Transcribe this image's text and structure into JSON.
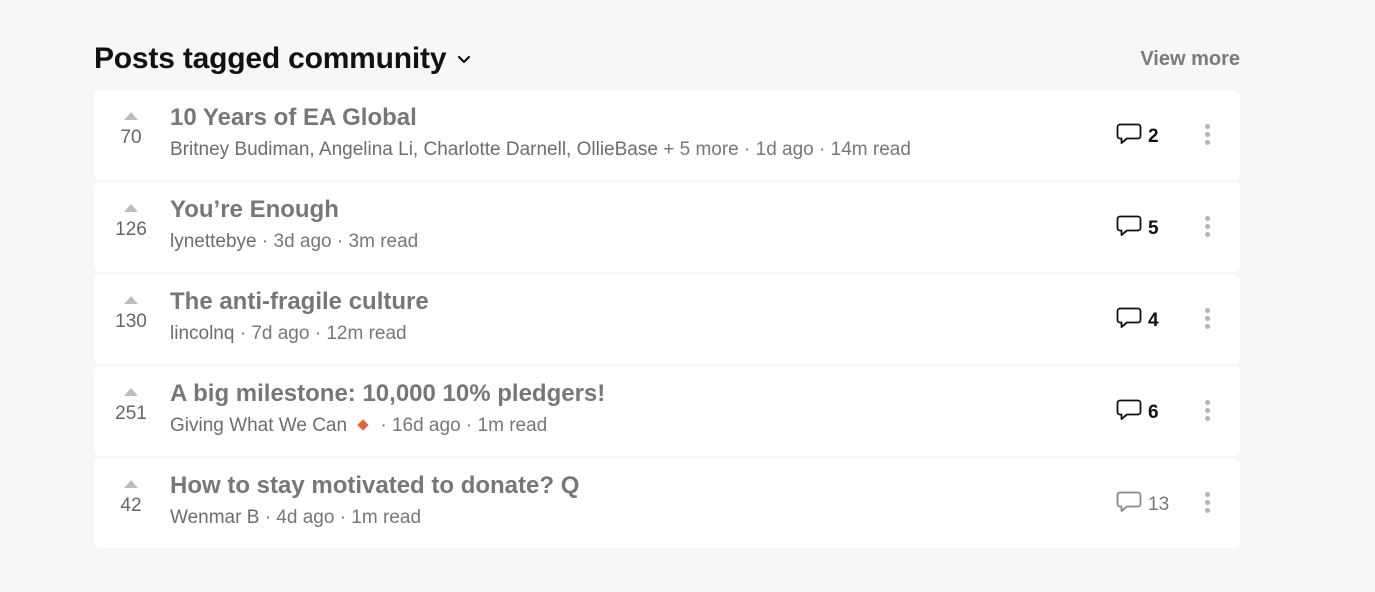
{
  "header": {
    "title": "Posts tagged community",
    "view_more": "View more"
  },
  "posts": [
    {
      "score": "70",
      "title": "10 Years of EA Global",
      "authors": "Britney Budiman, Angelina Li, Charlotte Darnell, OllieBase",
      "more": "+ 5 more",
      "age": "· 1d ago",
      "read": "· 14m read",
      "comments": "2",
      "comments_unread": true
    },
    {
      "score": "126",
      "title": "You’re Enough",
      "authors": "lynettebye",
      "age": "· 3d ago",
      "read": "· 3m read",
      "comments": "5",
      "comments_unread": true
    },
    {
      "score": "130",
      "title": "The anti-fragile culture",
      "authors": "lincolnq",
      "age": "· 7d ago",
      "read": "· 12m read",
      "comments": "4",
      "comments_unread": true
    },
    {
      "score": "251",
      "title": "A big milestone: 10,000 10% pledgers!",
      "authors": "Giving What We Can",
      "age": "· 16d ago",
      "read": "· 1m read",
      "comments": "6",
      "comments_unread": true,
      "author_badge_color": "#e0633d"
    },
    {
      "score": "42",
      "title": "How to stay motivated to donate?",
      "title_suffix": "Q",
      "authors": "Wenmar B",
      "age": "· 4d ago",
      "read": "· 1m read",
      "comments": "13",
      "comments_unread": false
    }
  ],
  "icons": {
    "vote_up": "triangle-up-icon",
    "comment": "speech-bubble-icon",
    "menu": "vertical-dots-icon",
    "dropdown": "chevron-down-icon"
  },
  "colors": {
    "background": "#f6f7f9",
    "card": "#ffffff",
    "badge": "#e0633d"
  }
}
